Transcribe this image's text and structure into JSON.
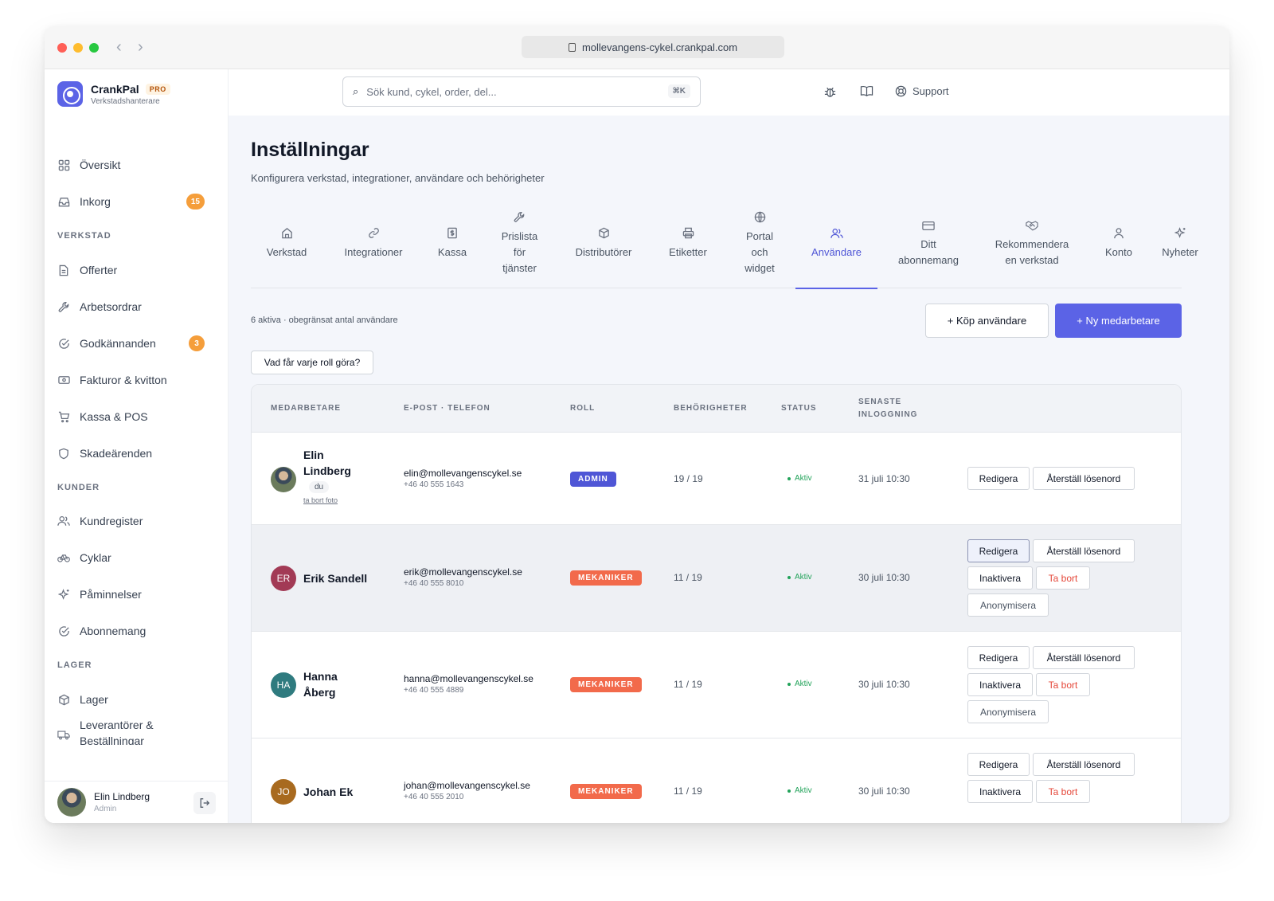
{
  "browser": {
    "url": "mollevangens-cykel.crankpal.com",
    "back": "‹",
    "forward": "›"
  },
  "brand": {
    "name": "CrankPal",
    "badge": "PRO",
    "subtitle": "Verkstadshanterare"
  },
  "search": {
    "placeholder": "Sök kund, cykel, order, del...",
    "shortcut": "⌘K"
  },
  "topbar": {
    "support_label": "Support"
  },
  "sidebar": {
    "top_items": [
      {
        "label": "Översikt",
        "icon": "grid-icon"
      },
      {
        "label": "Inkorg",
        "icon": "inbox-icon",
        "badge": "15"
      }
    ],
    "sections": [
      {
        "title": "VERKSTAD",
        "items": [
          {
            "label": "Offerter",
            "icon": "document-icon"
          },
          {
            "label": "Arbetsordrar",
            "icon": "wrench-icon"
          },
          {
            "label": "Godkännanden",
            "icon": "check-circle-icon",
            "badge": "3"
          },
          {
            "label": "Fakturor & kvitton",
            "icon": "banknote-icon"
          },
          {
            "label": "Kassa & POS",
            "icon": "cart-icon"
          },
          {
            "label": "Skadeärenden",
            "icon": "shield-icon"
          }
        ]
      },
      {
        "title": "KUNDER",
        "items": [
          {
            "label": "Kundregister",
            "icon": "users-icon"
          },
          {
            "label": "Cyklar",
            "icon": "bicycle-icon"
          },
          {
            "label": "Påminnelser",
            "icon": "sparkle-icon"
          },
          {
            "label": "Abonnemang",
            "icon": "check-circle-icon"
          }
        ]
      },
      {
        "title": "LAGER",
        "items": [
          {
            "label": "Lager",
            "icon": "box-icon"
          },
          {
            "label": "Leverantörer & Beställningar",
            "icon": "truck-icon"
          }
        ]
      }
    ],
    "user": {
      "name": "Elin Lindberg",
      "role": "Admin"
    }
  },
  "page": {
    "title": "Inställningar",
    "subtitle": "Konfigurera verkstad, integrationer, användare och behörigheter",
    "tabs": [
      {
        "label": "Verkstad",
        "icon": "home-icon"
      },
      {
        "label": "Integrationer",
        "icon": "link-icon"
      },
      {
        "label": "Kassa",
        "icon": "cash-register-icon"
      },
      {
        "label": "Prislista för tjänster",
        "icon": "wrench-icon"
      },
      {
        "label": "Distributörer",
        "icon": "package-icon"
      },
      {
        "label": "Etiketter",
        "icon": "printer-icon"
      },
      {
        "label": "Portal och widget",
        "icon": "globe-icon"
      },
      {
        "label": "Användare",
        "icon": "users-icon",
        "active": true
      },
      {
        "label": "Ditt abonnemang",
        "icon": "credit-card-icon"
      },
      {
        "label": "Rekommendera en verkstad",
        "icon": "handshake-icon"
      },
      {
        "label": "Konto",
        "icon": "user-icon"
      },
      {
        "label": "Nyheter",
        "icon": "sparkle-icon"
      }
    ],
    "summary": "6 aktiva · obegränsat antal användare",
    "buy_users": "+ Köp användare",
    "new_staff": "+ Ny medarbetare",
    "roles_help": "Vad får varje roll göra?"
  },
  "table": {
    "headers": {
      "staff": "MEDARBETARE",
      "contact": "E-POST · TELEFON",
      "role": "ROLL",
      "permissions": "BEHÖRIGHETER",
      "status": "STATUS",
      "last_login_1": "SENASTE",
      "last_login_2": "INLOGGNING"
    },
    "actions": {
      "edit": "Redigera",
      "reset": "Återställ lösenord",
      "deactivate": "Inaktivera",
      "remove": "Ta bort",
      "anonymize": "Anonymisera"
    },
    "rows": [
      {
        "name_line1": "Elin",
        "name_line2": "Lindberg",
        "you_badge": "du",
        "remove_photo": "ta bort foto",
        "email": "elin@mollevangenscykel.se",
        "phone": "+46 40 555 1643",
        "role": "ADMIN",
        "permissions": "19 / 19",
        "status": "Aktiv",
        "last_login": "31 juli 10:30"
      },
      {
        "name": "Erik Sandell",
        "initials": "ER",
        "avatar_color": "#a23a55",
        "email": "erik@mollevangenscykel.se",
        "phone": "+46 40 555 8010",
        "role": "MEKANIKER",
        "permissions": "11 / 19",
        "status": "Aktiv",
        "last_login": "30 juli 10:30"
      },
      {
        "name_line1": "Hanna",
        "name_line2": "Åberg",
        "initials": "HA",
        "avatar_color": "#2f7b7f",
        "email": "hanna@mollevangenscykel.se",
        "phone": "+46 40 555 4889",
        "role": "MEKANIKER",
        "permissions": "11 / 19",
        "status": "Aktiv",
        "last_login": "30 juli 10:30"
      },
      {
        "name": "Johan Ek",
        "initials": "JO",
        "avatar_color": "#a86a1f",
        "email": "johan@mollevangenscykel.se",
        "phone": "+46 40 555 2010",
        "role": "MEKANIKER",
        "permissions": "11 / 19",
        "status": "Aktiv",
        "last_login": "30 juli 10:30"
      }
    ]
  }
}
